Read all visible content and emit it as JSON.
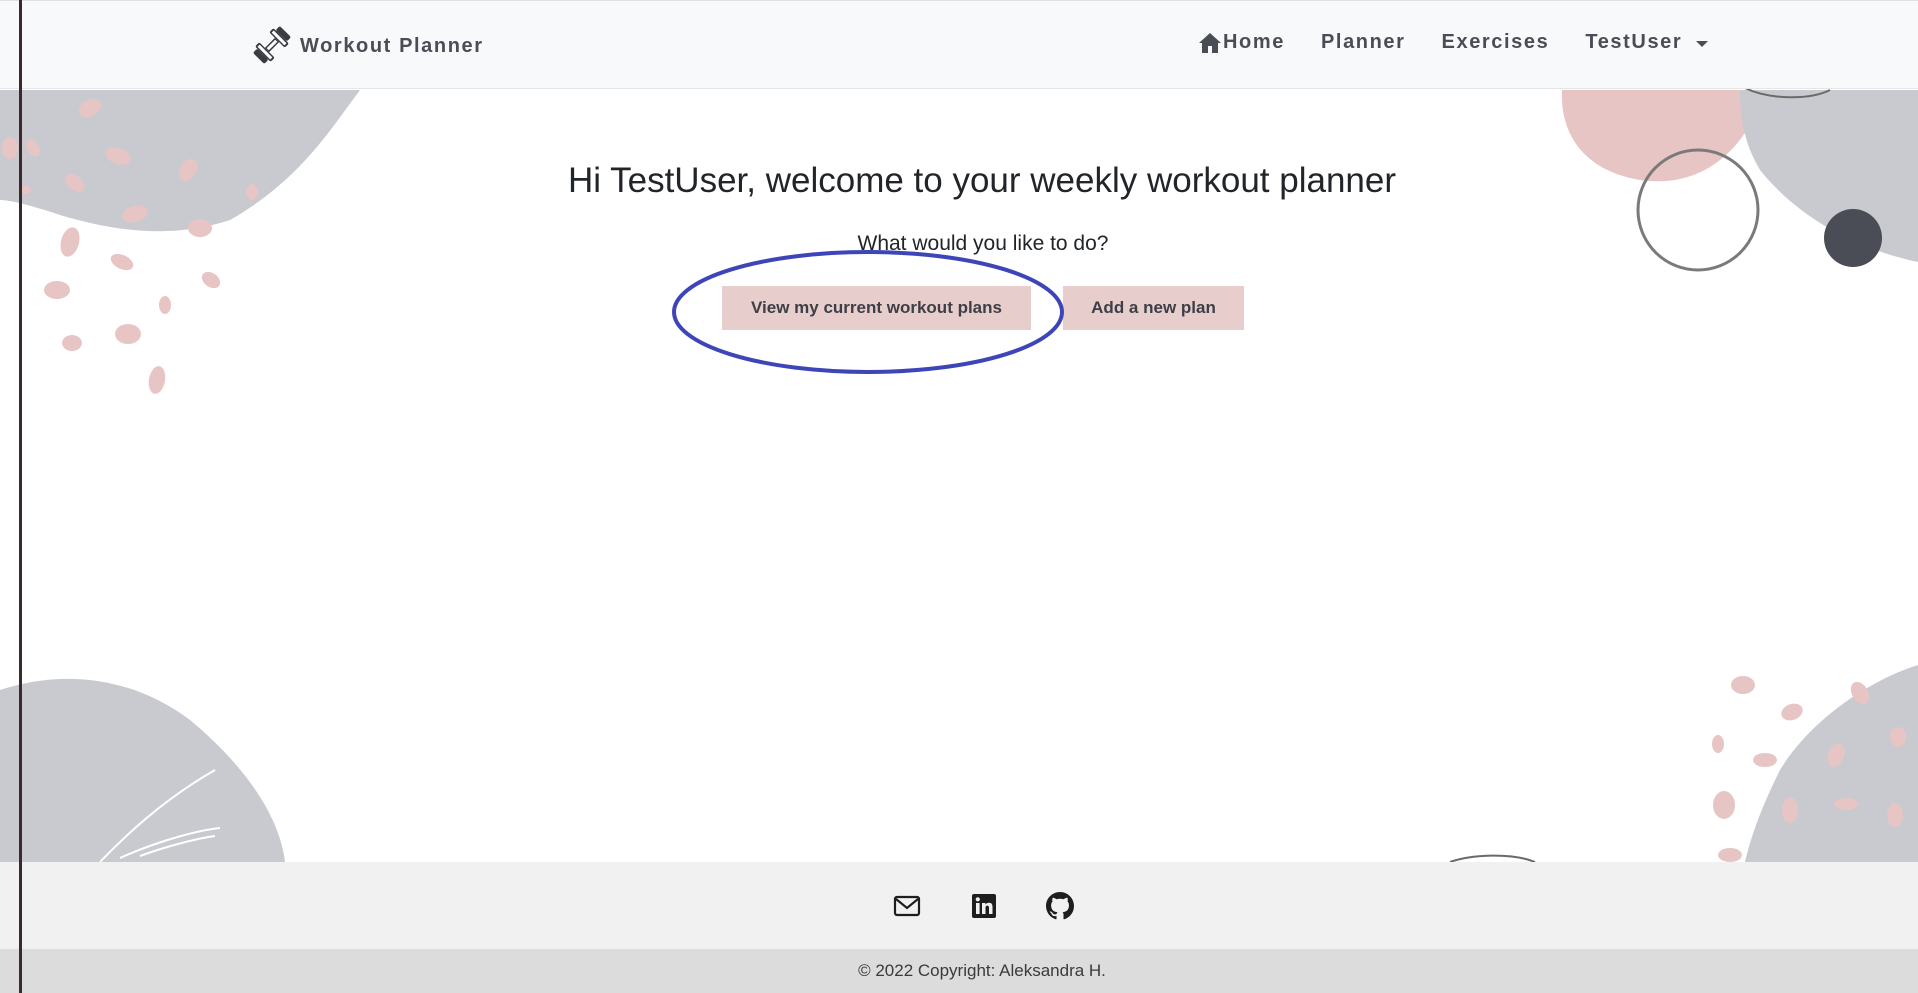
{
  "navbar": {
    "brand": "Workout Planner",
    "brand_icon": "dumbbell-icon",
    "links": {
      "home": "Home",
      "planner": "Planner",
      "exercises": "Exercises",
      "user": "TestUser"
    },
    "home_icon": "house-icon"
  },
  "main": {
    "welcome": "Hi TestUser, welcome to your weekly workout planner",
    "question": "What would you like to do?",
    "buttons": {
      "view_plans": "View my current workout plans",
      "add_plan": "Add a new plan"
    }
  },
  "footer": {
    "icons": [
      "envelope-icon",
      "linkedin-icon",
      "github-icon"
    ],
    "copyright": "© 2022 Copyright: Aleksandra H."
  },
  "colors": {
    "button_bg": "#e8cdcd",
    "highlight_ellipse": "#3d45b8",
    "navbar_bg": "#f8f9fa",
    "footer_bg": "#f1f1f1",
    "copyright_bg": "#dcdcdc",
    "deco_grey": "#c8cacf",
    "deco_pink": "#e8c5c5",
    "deco_dark": "#4a4d55"
  }
}
